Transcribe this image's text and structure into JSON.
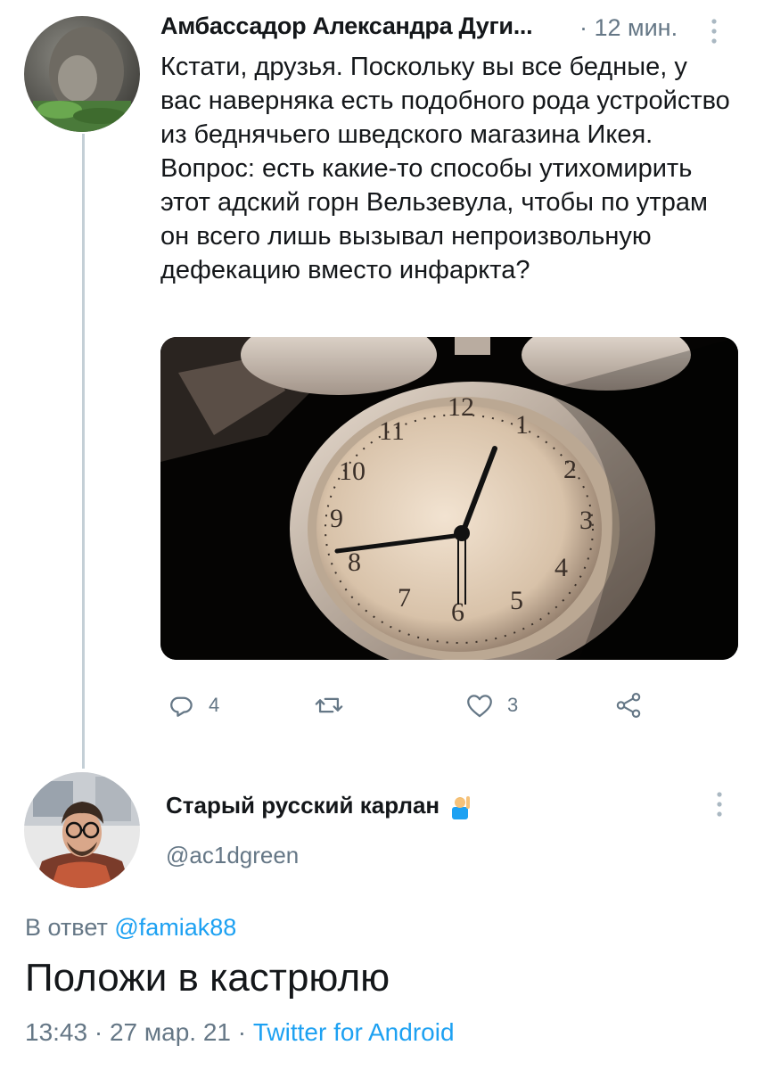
{
  "parent_tweet": {
    "author_name": "Амбассадор Александра Дуги...",
    "time": "· 12 мин.",
    "text": "Кстати, друзья. Поскольку вы все бедные, у вас наверняка есть подобного рода устройство из беднячьего шведского магазина Икея. Вопрос: есть какие-то способы утихомирить этот адский горн Вельзевула, чтобы по утрам он всего лишь вызывал непроизвольную дефекацию вместо инфаркта?",
    "photo_icon": "alarm-clock-photo",
    "actions": {
      "reply_count": "4",
      "retweet_count": "",
      "like_count": "3"
    },
    "avatar_icon": "user-avatar"
  },
  "reply_tweet": {
    "author_name": "Старый русский карлан",
    "emoji_icon": "man-raising-hand-emoji",
    "handle": "@ac1dgreen",
    "reply_to_prefix": "В ответ",
    "reply_to_mention": "@famiak88",
    "text": "Положи в кастрюлю",
    "time_date": "13:43 · 27 мар. 21 ·",
    "source": "Twitter for Android",
    "avatar_icon": "user-avatar-glasses"
  },
  "colors": {
    "text": "#14171a",
    "secondary": "#657786",
    "link": "#1da1f2",
    "thread_line": "#c4cfd6"
  }
}
